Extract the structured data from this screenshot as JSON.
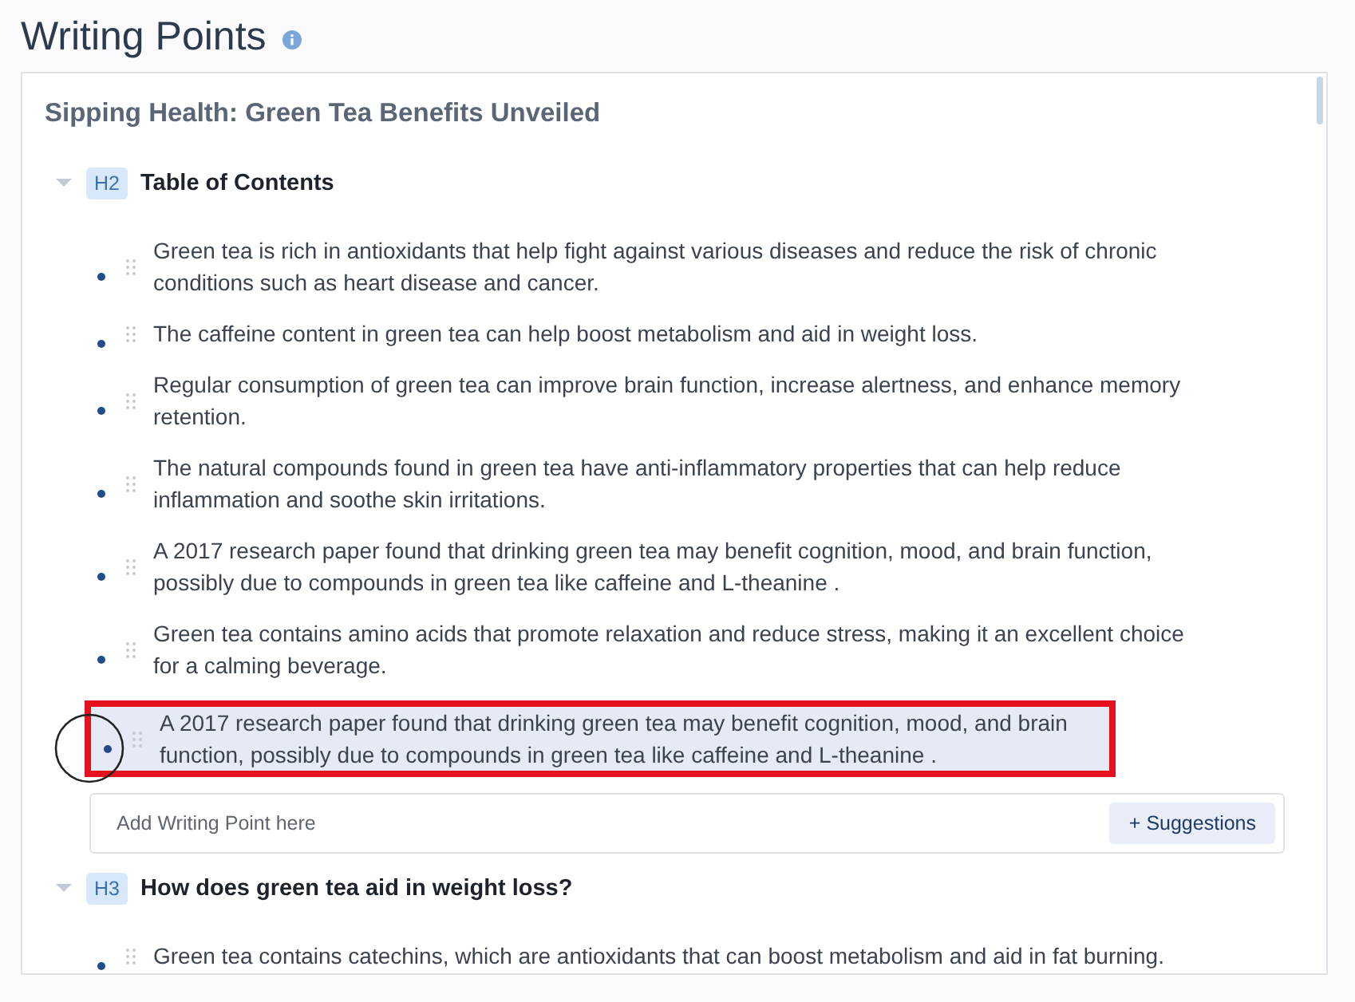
{
  "title": "Writing Points",
  "article": {
    "title": "Sipping Health: Green Tea Benefits Unveiled",
    "sections": [
      {
        "level": "H2",
        "heading": "Table of Contents",
        "expanded": true,
        "points": [
          {
            "text": "Green tea is rich in antioxidants that help fight against various diseases and reduce the risk of chronic conditions such as heart disease and cancer.",
            "selected": false
          },
          {
            "text": "The caffeine content in green tea can help boost metabolism and aid in weight loss.",
            "selected": false
          },
          {
            "text": "Regular consumption of green tea can improve brain function, increase alertness, and enhance memory retention.",
            "selected": false
          },
          {
            "text": "The natural compounds found in green tea have anti-inflammatory properties that can help reduce inflammation and soothe skin irritations.",
            "selected": false
          },
          {
            "text": "A 2017 research paper found that drinking green tea may benefit cognition, mood, and brain function, possibly due to compounds in green tea like caffeine and L-theanine .",
            "selected": false
          },
          {
            "text": "Green tea contains amino acids that promote relaxation and reduce stress, making it an excellent choice for a calming beverage.",
            "selected": false
          },
          {
            "text": "A 2017 research paper found that drinking green tea may benefit cognition, mood, and brain function, possibly due to compounds in green tea like caffeine and L-theanine .",
            "selected": true
          }
        ],
        "add_field": {
          "placeholder": "Add Writing Point here"
        },
        "suggestions_button": "+ Suggestions"
      },
      {
        "level": "H3",
        "heading": "How does green tea aid in weight loss?",
        "expanded": true,
        "points": [
          {
            "text": "Green tea contains catechins, which are antioxidants that can boost metabolism and aid in fat burning.",
            "selected": false
          }
        ]
      }
    ]
  }
}
